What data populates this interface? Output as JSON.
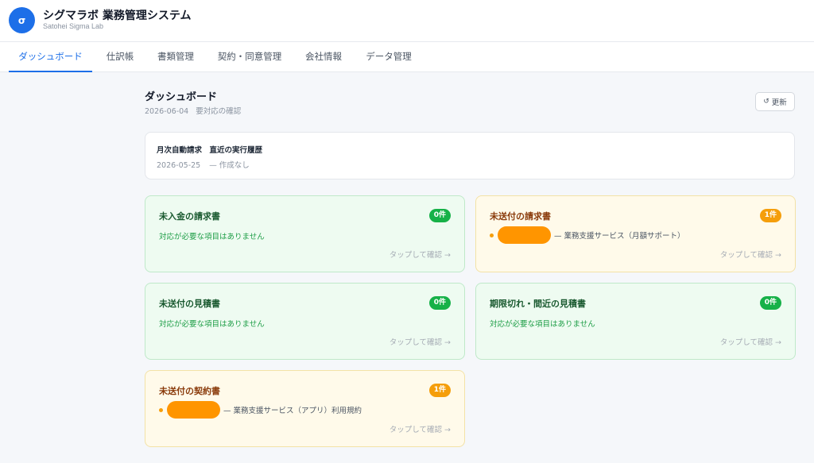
{
  "header": {
    "logo_char": "σ",
    "title": "シグマラボ 業務管理システム",
    "subtitle": "Satohei Sigma Lab"
  },
  "nav": {
    "tabs": [
      {
        "label": "ダッシュボード",
        "active": true
      },
      {
        "label": "仕訳帳"
      },
      {
        "label": "書類管理"
      },
      {
        "label": "契約・同意管理"
      },
      {
        "label": "会社情報"
      },
      {
        "label": "データ管理"
      }
    ]
  },
  "page": {
    "title": "ダッシュボード",
    "date": "2026-06-04",
    "date_note": "要対応の確認",
    "refresh_icon": "↺",
    "refresh_label": "更新"
  },
  "history": {
    "title": "月次自動請求　直近の実行履歴",
    "date": "2026-05-25",
    "status": "— 作成なし"
  },
  "cards": [
    {
      "title": "未入金の請求書",
      "badge": "0件",
      "message": "対応が必要な項目はありません",
      "link": "タップして確認 →",
      "tone": "green"
    },
    {
      "title": "未送付の請求書",
      "badge": "1件",
      "item": "— 業務支援サービス（月額サポート）",
      "link": "タップして確認 →",
      "tone": "amber"
    },
    {
      "title": "未送付の見積書",
      "badge": "0件",
      "message": "対応が必要な項目はありません",
      "link": "タップして確認 →",
      "tone": "green"
    },
    {
      "title": "期限切れ・間近の見積書",
      "badge": "0件",
      "message": "対応が必要な項目はありません",
      "link": "タップして確認 →",
      "tone": "green"
    },
    {
      "title": "未送付の契約書",
      "badge": "1件",
      "item": "— 業務支援サービス（アプリ）利用規約",
      "link": "タップして確認 →",
      "tone": "amber"
    }
  ],
  "colors": {
    "accent": "#1d6fe8",
    "ok_badge": "#16b148",
    "warn_badge": "#f59e0b",
    "redaction": "#ff9500"
  }
}
